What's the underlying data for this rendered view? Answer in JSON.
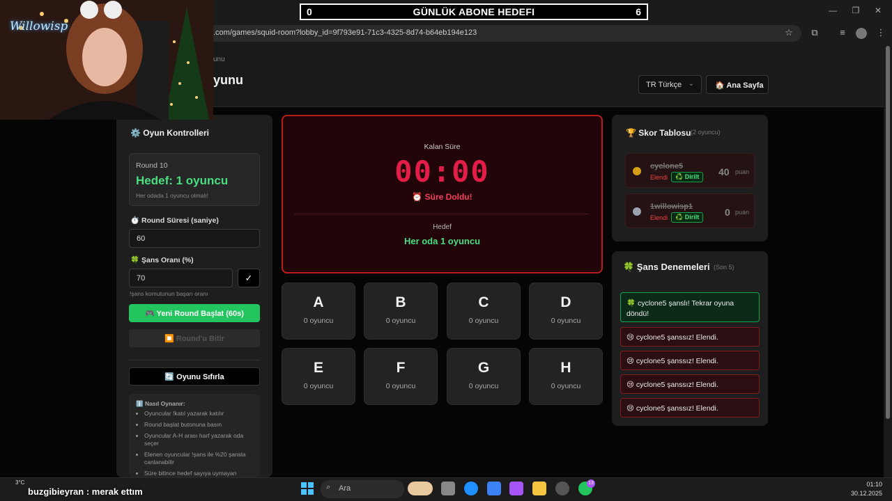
{
  "banner": {
    "left": "0",
    "title": "GÜNLÜK ABONE HEDEFI",
    "right": "6"
  },
  "browser": {
    "url": ".com/games/squid-room?lobby_id=9f793e91-71c3-4325-8d74-b64eb194e123"
  },
  "header": {
    "breadcrumb": "unu",
    "title": "yunu",
    "language": "TR Türkçe",
    "home_label": "🏠 Ana Sayfa"
  },
  "controls": {
    "title": "⚙️ Oyun Kontrolleri",
    "round_label": "Round 10",
    "goal": "Hedef: 1 oyuncu",
    "goal_note": "Her odada 1 oyuncu olmalı!",
    "duration_label": "⏱️ Round Süresi (saniye)",
    "duration_value": "60",
    "chance_label": "🍀 Şans Oranı (%)",
    "chance_value": "70",
    "check": "✓",
    "chance_hint": "!şans komutunun başarı oranı",
    "start_btn": "🎮 Yeni Round Başlat (60s)",
    "end_btn": "⏹️ Round'u Bitir",
    "reset_btn": "🔄 Oyunu Sıfırla",
    "howto_title": "ℹ️ Nasıl Oynanır:",
    "howto_items": [
      "Oyuncular !katıl yazarak katılır",
      "Round başlat butonuna basın",
      "Oyuncular A-H arası harf yazarak oda seçer",
      "Elenen oyuncular !şans ile %20 şansla canlanabilir",
      "Süre bitince hedef sayıya uymayan"
    ]
  },
  "timer": {
    "label": "Kalan Süre",
    "value": "00:00",
    "status": "⏰ Süre Doldu!",
    "goal_label": "Hedef",
    "goal_value": "Her oda 1 oyuncu"
  },
  "rooms": [
    {
      "letter": "A",
      "count": "0 oyuncu"
    },
    {
      "letter": "B",
      "count": "0 oyuncu"
    },
    {
      "letter": "C",
      "count": "0 oyuncu"
    },
    {
      "letter": "D",
      "count": "0 oyuncu"
    },
    {
      "letter": "E",
      "count": "0 oyuncu"
    },
    {
      "letter": "F",
      "count": "0 oyuncu"
    },
    {
      "letter": "G",
      "count": "0 oyuncu"
    },
    {
      "letter": "H",
      "count": "0 oyuncu"
    }
  ],
  "scoreboard": {
    "title": "🏆 Skor Tablosu",
    "subtitle": "(2 oyuncu)",
    "rows": [
      {
        "name": "cyclone5",
        "status": "Elendi",
        "revive": "♻️ Dirilt",
        "points": "40",
        "unit": "puan"
      },
      {
        "name": "1willowisp1",
        "status": "Elendi",
        "revive": "♻️ Dirilt",
        "points": "0",
        "unit": "puan"
      }
    ]
  },
  "luck": {
    "title": "🍀 Şans Denemeleri",
    "subtitle": "(Son 5)",
    "success": "🍀 cyclone5 şanslı! Tekrar oyuna döndü!",
    "fails": [
      "😢 cyclone5 şanssız! Elendi.",
      "😢 cyclone5 şanssız! Elendi.",
      "😢 cyclone5 şanssız! Elendi.",
      "😢 cyclone5 şanssız! Elendi."
    ]
  },
  "stream": {
    "chat_user": "buzgibieyran",
    "chat_msg": ": merak ettım",
    "temp": "3°C",
    "overlay_name": "Willowisp"
  },
  "taskbar": {
    "search": "Ara",
    "time": "01:10",
    "date": "30.12.2025",
    "badge": "13"
  }
}
